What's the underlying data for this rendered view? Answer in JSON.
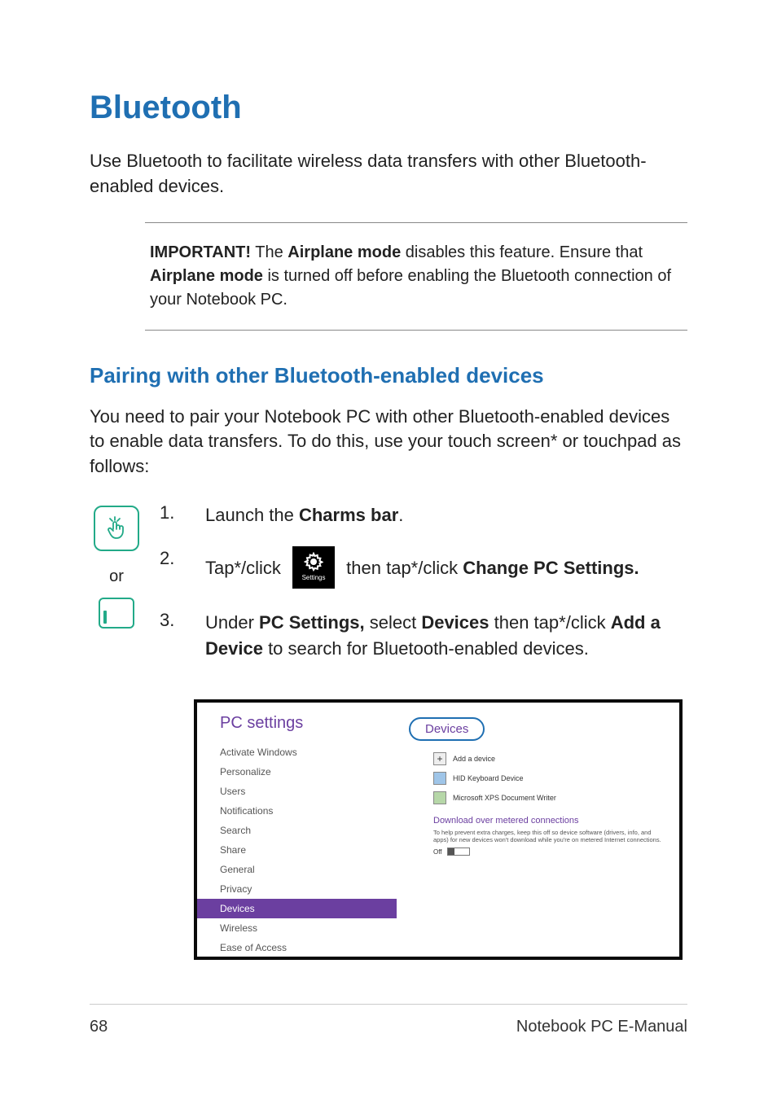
{
  "h1": "Bluetooth",
  "intro": "Use Bluetooth to facilitate wireless data transfers with other Bluetooth-enabled devices.",
  "important_label": "IMPORTANT!",
  "important_1": " The ",
  "important_bold_a": "Airplane mode",
  "important_2": " disables this feature. Ensure that ",
  "important_bold_b": "Airplane mode",
  "important_3": " is turned off before enabling the Bluetooth connection of your Notebook PC.",
  "h2": "Pairing with other Bluetooth-enabled devices",
  "p2": "You need to pair your Notebook PC with other Bluetooth-enabled devices to enable data transfers. To do this, use your touch screen* or touchpad as follows:",
  "or": "or",
  "steps": {
    "s1_num": "1.",
    "s1_a": "Launch the ",
    "s1_b": "Charms bar",
    "s1_c": ".",
    "s2_num": "2.",
    "s2_a": "Tap*/click ",
    "s2_icon_label": "Settings",
    "s2_b": " then tap*/click ",
    "s2_c": "Change PC Settings.",
    "s3_num": "3.",
    "s3_a": "Under ",
    "s3_b": "PC Settings,",
    "s3_c": " select ",
    "s3_d": "Devices",
    "s3_e": " then tap*/click ",
    "s3_f": "Add a Device",
    "s3_g": " to search for Bluetooth-enabled devices."
  },
  "screenshot": {
    "heading": "PC settings",
    "items": [
      "Activate Windows",
      "Personalize",
      "Users",
      "Notifications",
      "Search",
      "Share",
      "General",
      "Privacy",
      "Devices",
      "Wireless",
      "Ease of Access"
    ],
    "active_index": 8,
    "right_title": "Devices",
    "add_label": "Add a device",
    "dev1": "HID Keyboard Device",
    "dev2": "Microsoft XPS Document Writer",
    "metered_title": "Download over metered connections",
    "metered_desc": "To help prevent extra charges, keep this off so device software (drivers, info, and apps) for new devices won't download while you're on metered Internet connections.",
    "toggle_label": "Off"
  },
  "footer": {
    "page": "68",
    "title": "Notebook PC E-Manual"
  }
}
